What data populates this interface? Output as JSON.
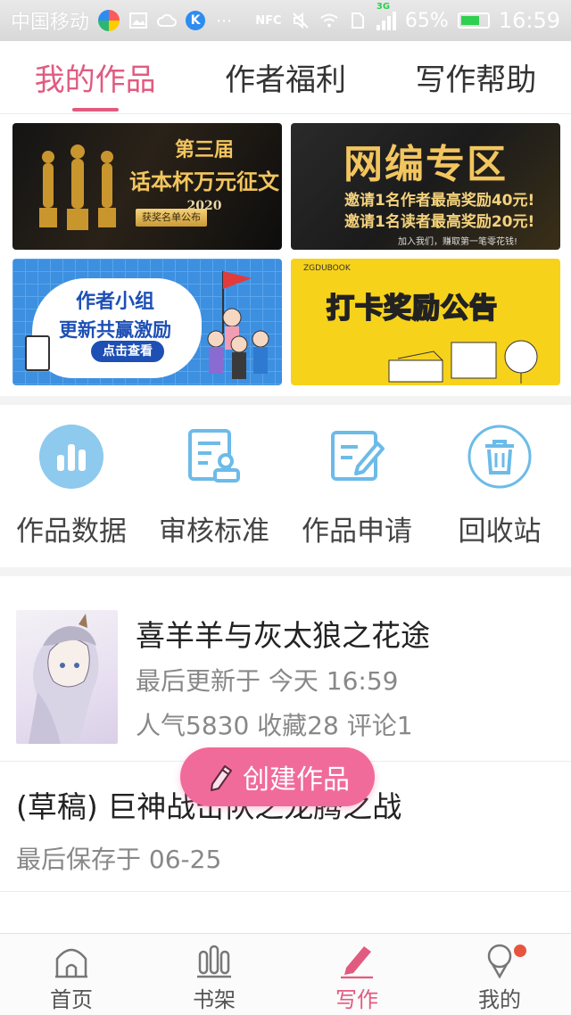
{
  "status_bar": {
    "carrier": "中国移动",
    "network": "3G",
    "battery": "65%",
    "time": "16:59"
  },
  "tabs": [
    {
      "label": "我的作品",
      "active": true
    },
    {
      "label": "作者福利",
      "active": false
    },
    {
      "label": "写作帮助",
      "active": false
    }
  ],
  "banners": {
    "banner1": {
      "line1": "第三届",
      "line2": "话本杯万元征文",
      "year": "2020",
      "button": "获奖名单公布"
    },
    "banner2": {
      "title": "网编专区",
      "line1": "邀请1名作者最高奖励40元!",
      "line2": "邀请1名读者最高奖励20元!",
      "footer": "加入我们，赚取第一笔零花钱!"
    },
    "banner3": {
      "line1": "作者小组",
      "line2": "更新共赢激励",
      "button": "点击查看"
    },
    "banner4": {
      "brand": "ZGDUBOOK",
      "title": "打卡奖励公告"
    }
  },
  "actions": [
    {
      "label": "作品数据",
      "icon": "bar-chart-icon"
    },
    {
      "label": "审核标准",
      "icon": "review-document-icon"
    },
    {
      "label": "作品申请",
      "icon": "edit-document-icon"
    },
    {
      "label": "回收站",
      "icon": "trash-icon"
    }
  ],
  "works": [
    {
      "title": "喜羊羊与灰太狼之花途",
      "updated": "最后更新于 今天 16:59",
      "stats": "人气5830 收藏28 评论1"
    }
  ],
  "drafts": [
    {
      "title": "(草稿) 巨神战击队之龙腾之战",
      "saved": "最后保存于 06-25"
    }
  ],
  "create_button": {
    "label": "创建作品"
  },
  "bottom_nav": [
    {
      "label": "首页",
      "icon": "home-icon",
      "active": false
    },
    {
      "label": "书架",
      "icon": "bookshelf-icon",
      "active": false
    },
    {
      "label": "写作",
      "icon": "pen-icon",
      "active": true
    },
    {
      "label": "我的",
      "icon": "profile-icon",
      "active": false,
      "badge": true
    }
  ],
  "colors": {
    "accent": "#e15b80",
    "create_button": "#f06b9a",
    "action_icon": "#6cbbe8",
    "badge": "#e8553f"
  }
}
